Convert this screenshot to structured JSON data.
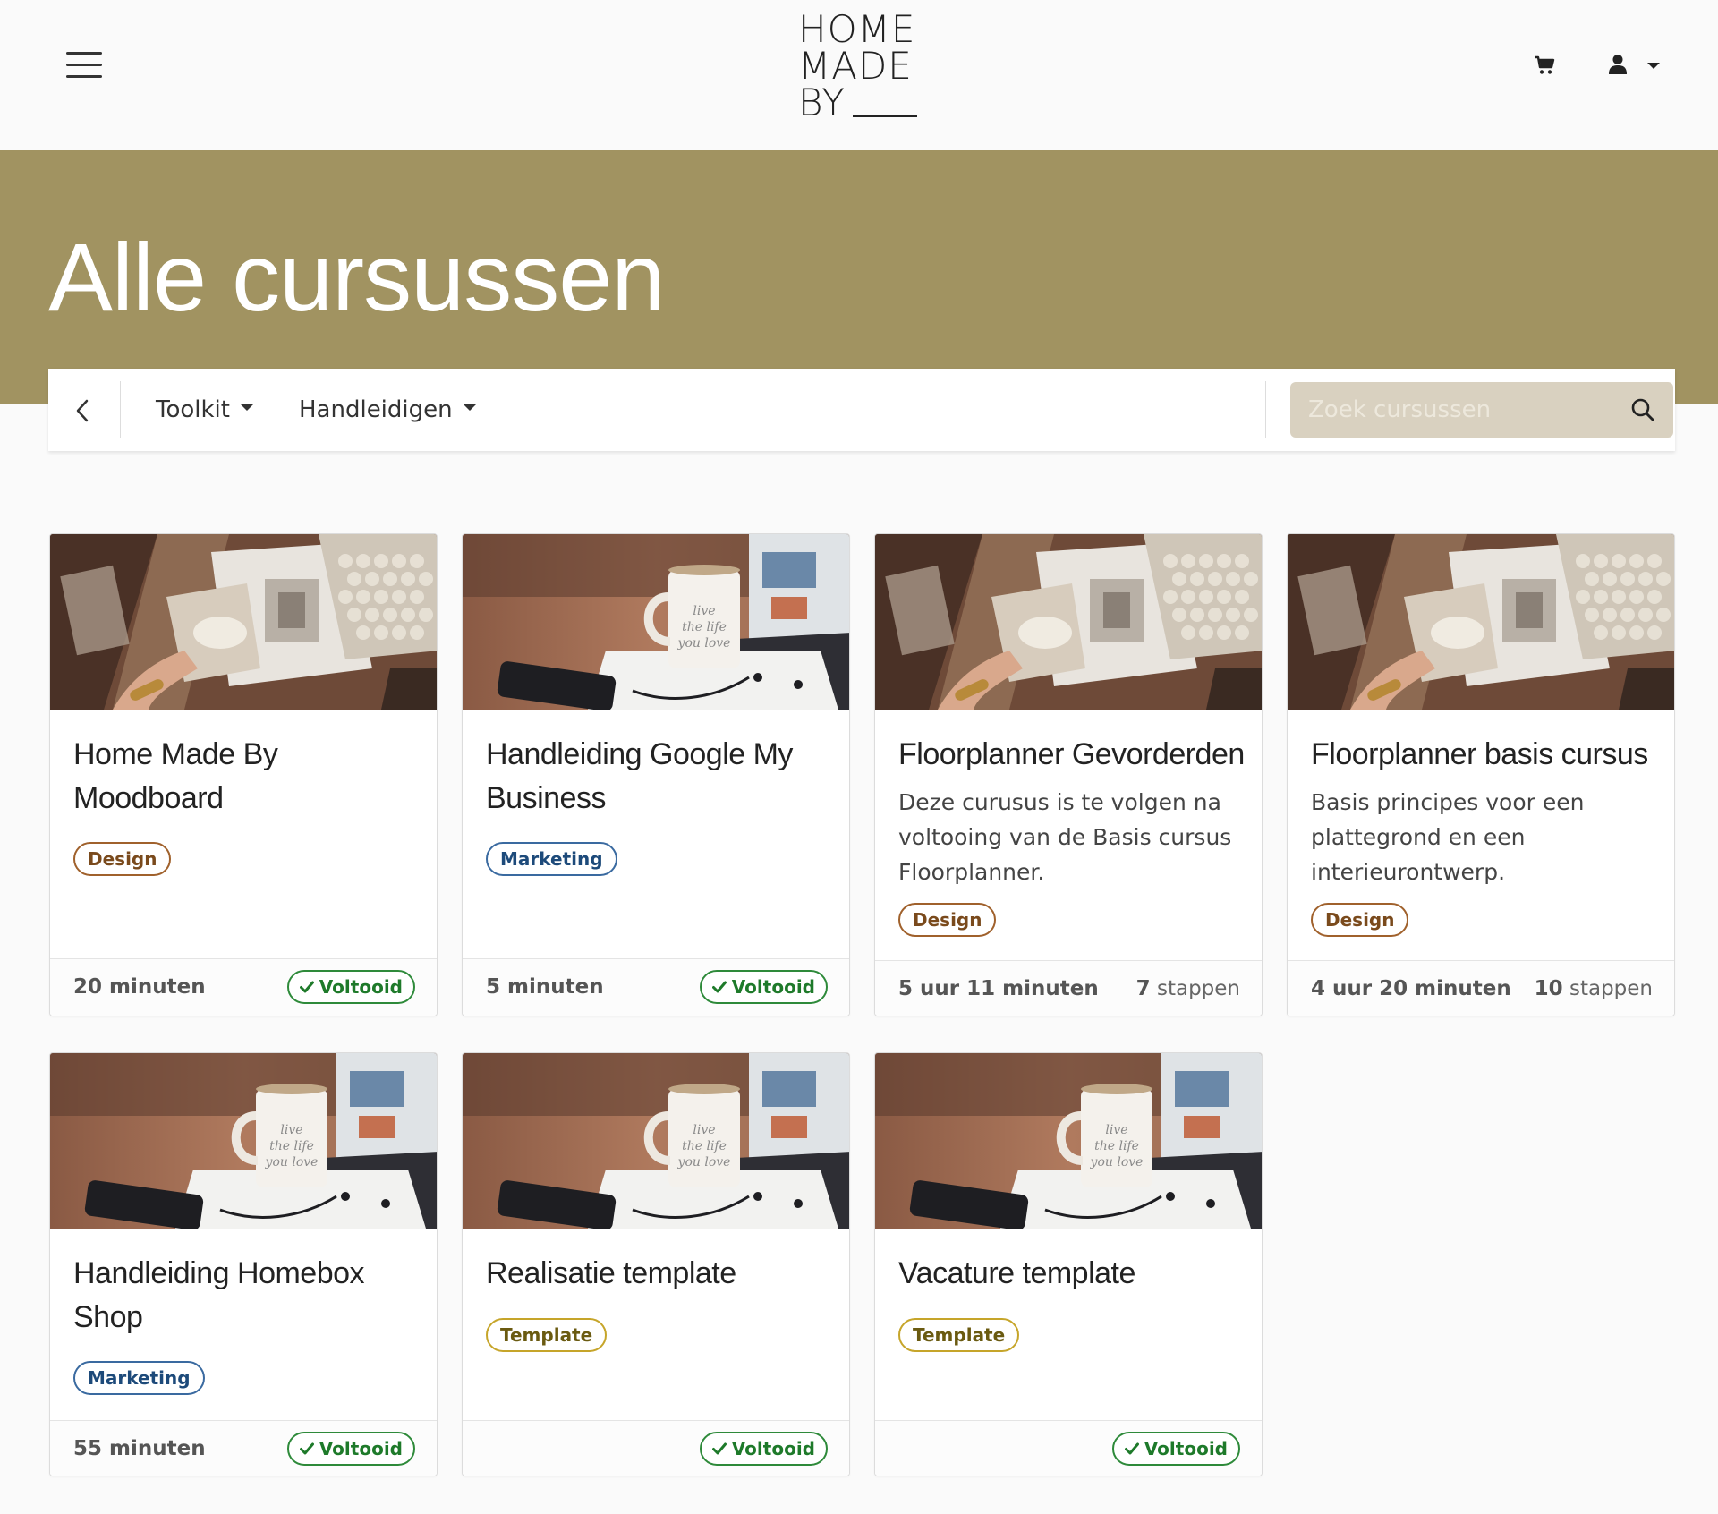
{
  "header": {
    "logo_line1": "HOME",
    "logo_line2": "MADE",
    "logo_line3": "BY"
  },
  "hero": {
    "title": "Alle cursussen",
    "background": "#a19361"
  },
  "filters": {
    "menus": [
      {
        "label": "Toolkit"
      },
      {
        "label": "Handleidigen"
      }
    ],
    "search_placeholder": "Zoek cursussen"
  },
  "courses": [
    {
      "title": "Home Made By Moodboard",
      "description": "",
      "tag": "Design",
      "duration": "20 minuten",
      "status": "Voltooid",
      "steps_count": "",
      "steps_label": "",
      "image": "moodboard"
    },
    {
      "title": "Handleiding Google My Business",
      "description": "",
      "tag": "Marketing",
      "duration": "5 minuten",
      "status": "Voltooid",
      "steps_count": "",
      "steps_label": "",
      "image": "coffee-mug"
    },
    {
      "title": "Floorplanner Gevorderden",
      "description": "Deze curusus is te volgen na voltooing van de Basis cursus Floorplanner.",
      "tag": "Design",
      "duration": "5 uur 11 minuten",
      "status": "",
      "steps_count": "7",
      "steps_label": "stappen",
      "image": "moodboard"
    },
    {
      "title": "Floorplanner basis cursus",
      "description": "Basis principes voor een plattegrond en een interieurontwerp.",
      "tag": "Design",
      "duration": "4 uur 20 minuten",
      "status": "",
      "steps_count": "10",
      "steps_label": "stappen",
      "image": "moodboard"
    },
    {
      "title": "Handleiding Homebox Shop",
      "description": "",
      "tag": "Marketing",
      "duration": "55 minuten",
      "status": "Voltooid",
      "steps_count": "",
      "steps_label": "",
      "image": "coffee-mug"
    },
    {
      "title": "Realisatie template",
      "description": "",
      "tag": "Template",
      "duration": "",
      "status": "Voltooid",
      "steps_count": "",
      "steps_label": "",
      "image": "coffee-mug"
    },
    {
      "title": "Vacature template",
      "description": "",
      "tag": "Template",
      "duration": "",
      "status": "Voltooid",
      "steps_count": "",
      "steps_label": "",
      "image": "coffee-mug"
    }
  ],
  "colors": {
    "design": "#a0612c",
    "marketing": "#3a6aa0",
    "template": "#c6a52a",
    "done": "#2e8a3a",
    "search_bg": "#d9d1c0"
  },
  "icons": [
    "hamburger-menu-icon",
    "cart-icon",
    "user-icon",
    "chevron-left-icon",
    "search-icon",
    "check-icon"
  ]
}
